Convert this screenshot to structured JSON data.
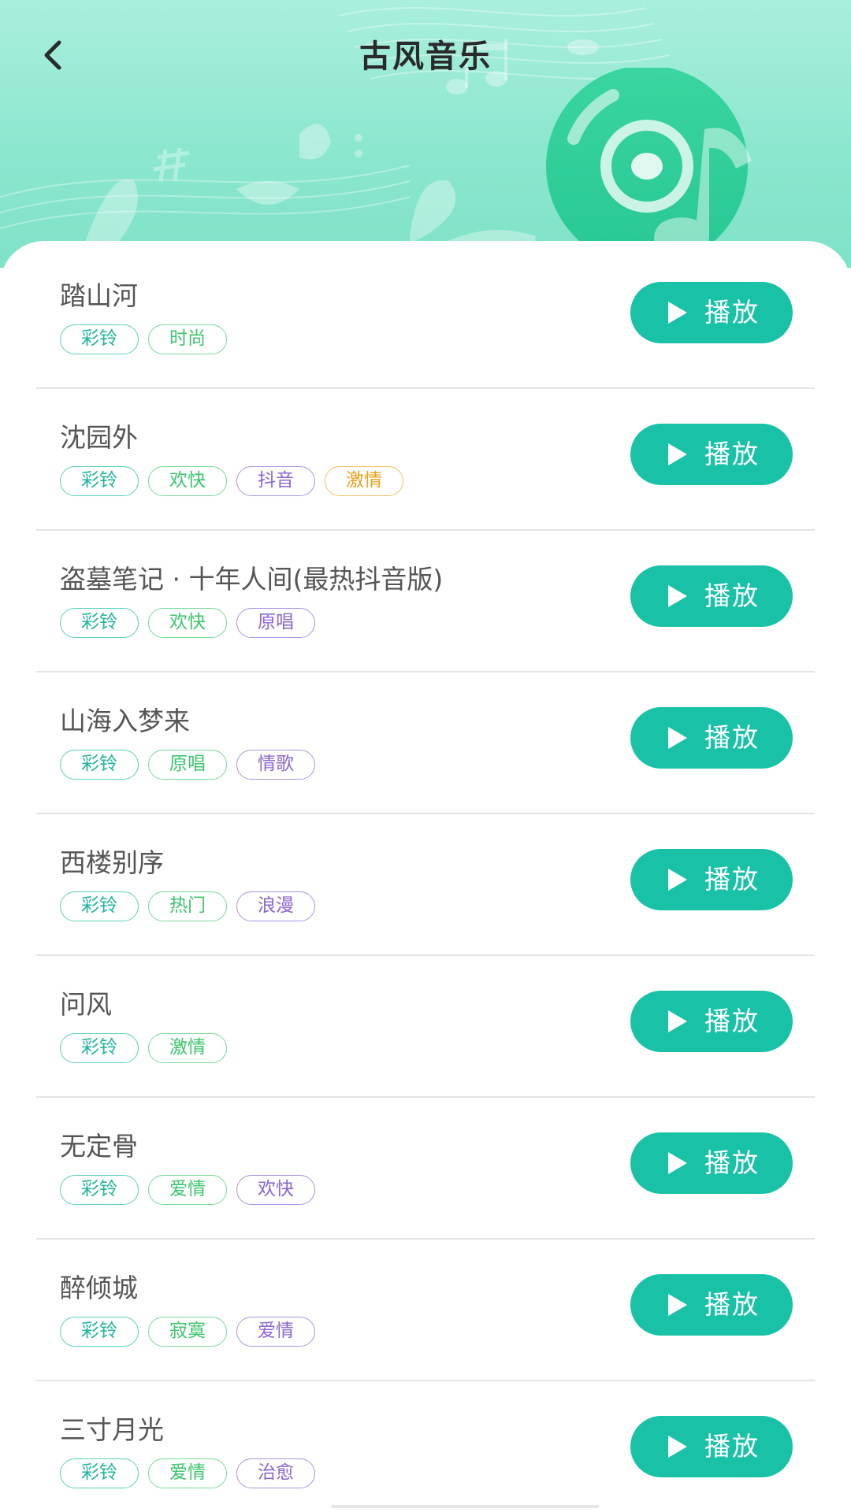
{
  "header": {
    "title": "古风音乐",
    "back_icon": "chevron-left-icon"
  },
  "colors": {
    "accent": "#19c2a6",
    "header_bg": "#8ce7cf",
    "tag_teal": "#20b69c",
    "tag_green": "#3cc56c",
    "tag_purple": "#8a66cf",
    "tag_orange": "#e9a21e"
  },
  "play_label": "播放",
  "songs": [
    {
      "title": "踏山河",
      "tags": [
        {
          "label": "彩铃",
          "color": "teal"
        },
        {
          "label": "时尚",
          "color": "green"
        }
      ]
    },
    {
      "title": "沈园外",
      "tags": [
        {
          "label": "彩铃",
          "color": "teal"
        },
        {
          "label": "欢快",
          "color": "green"
        },
        {
          "label": "抖音",
          "color": "purple"
        },
        {
          "label": "激情",
          "color": "orange"
        }
      ]
    },
    {
      "title": "盗墓笔记 · 十年人间(最热抖音版)",
      "tags": [
        {
          "label": "彩铃",
          "color": "teal"
        },
        {
          "label": "欢快",
          "color": "green"
        },
        {
          "label": "原唱",
          "color": "purple"
        }
      ]
    },
    {
      "title": "山海入梦来",
      "tags": [
        {
          "label": "彩铃",
          "color": "teal"
        },
        {
          "label": "原唱",
          "color": "green"
        },
        {
          "label": "情歌",
          "color": "purple"
        }
      ]
    },
    {
      "title": "西楼别序",
      "tags": [
        {
          "label": "彩铃",
          "color": "teal"
        },
        {
          "label": "热门",
          "color": "green"
        },
        {
          "label": "浪漫",
          "color": "purple"
        }
      ]
    },
    {
      "title": "问风",
      "tags": [
        {
          "label": "彩铃",
          "color": "teal"
        },
        {
          "label": "激情",
          "color": "green"
        }
      ]
    },
    {
      "title": "无定骨",
      "tags": [
        {
          "label": "彩铃",
          "color": "teal"
        },
        {
          "label": "爱情",
          "color": "green"
        },
        {
          "label": "欢快",
          "color": "purple"
        }
      ]
    },
    {
      "title": "醉倾城",
      "tags": [
        {
          "label": "彩铃",
          "color": "teal"
        },
        {
          "label": "寂寞",
          "color": "green"
        },
        {
          "label": "爱情",
          "color": "purple"
        }
      ]
    },
    {
      "title": "三寸月光",
      "tags": [
        {
          "label": "彩铃",
          "color": "teal"
        },
        {
          "label": "爱情",
          "color": "green"
        },
        {
          "label": "治愈",
          "color": "purple"
        }
      ]
    }
  ]
}
